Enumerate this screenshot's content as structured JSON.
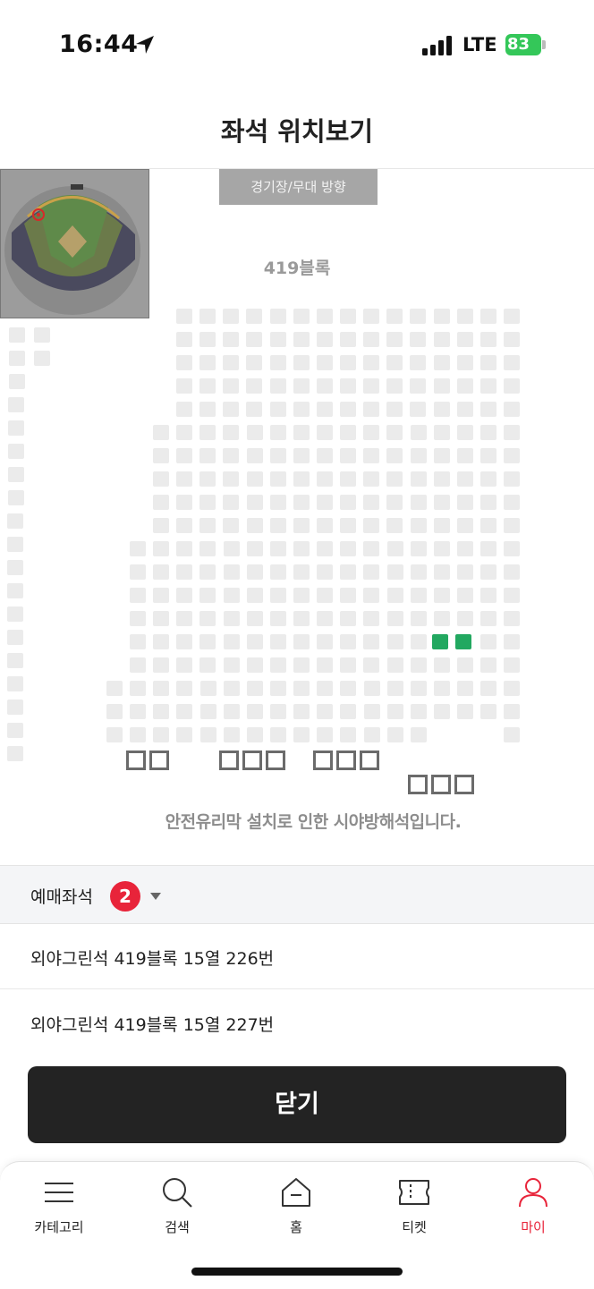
{
  "status_bar": {
    "time": "16:44",
    "network": "LTE",
    "battery": "83"
  },
  "page": {
    "title": "좌석 위치보기"
  },
  "seat_map": {
    "stage_direction_label": "경기장/무대 방향",
    "block_label": "419블록",
    "obstruction_note": "안전유리막 설치로 인한 시야방해석입니다.",
    "selected_seat_color": "#22a860"
  },
  "reserved": {
    "label": "예매좌석",
    "count": "2",
    "seats": [
      "외야그린석 419블록 15열 226번",
      "외야그린석 419블록 15열 227번"
    ]
  },
  "close_label": "닫기",
  "tabbar": {
    "accent_color": "#e8243a",
    "tabs": [
      {
        "label": "카테고리",
        "icon": "menu-icon"
      },
      {
        "label": "검색",
        "icon": "search-icon"
      },
      {
        "label": "홈",
        "icon": "home-icon"
      },
      {
        "label": "티켓",
        "icon": "ticket-icon"
      },
      {
        "label": "마이",
        "icon": "user-icon",
        "active": true
      }
    ]
  }
}
